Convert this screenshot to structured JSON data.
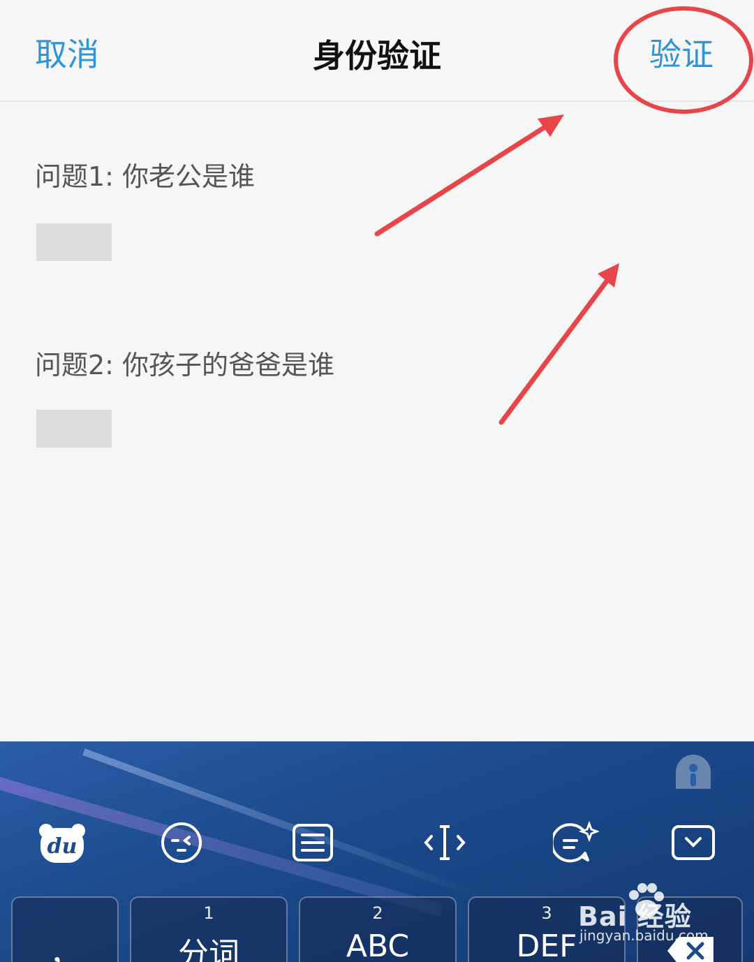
{
  "navbar": {
    "cancel_label": "取消",
    "title": "身份验证",
    "verify_label": "验证"
  },
  "questions": [
    {
      "label": "问题1: 你老公是谁"
    },
    {
      "label": "问题2: 你孩子的爸爸是谁"
    }
  ],
  "annotation": {
    "color": "#e8454b"
  },
  "keyboard": {
    "toolbar": [
      {
        "icon": "du-bear-logo-icon"
      },
      {
        "icon": "emoji-face-icon"
      },
      {
        "icon": "keyboard-layout-icon"
      },
      {
        "icon": "cursor-move-icon"
      },
      {
        "icon": "ai-chat-sparkle-icon"
      },
      {
        "icon": "collapse-keyboard-icon"
      }
    ],
    "keys": [
      {
        "num": "",
        "label": "，"
      },
      {
        "num": "1",
        "label": "分词"
      },
      {
        "num": "2",
        "label": "ABC"
      },
      {
        "num": "3",
        "label": "DEF"
      },
      {
        "num": "",
        "label": "delete-icon"
      }
    ]
  },
  "watermark": {
    "brand": "Bai  经验",
    "url": "jingyan.baidu.com"
  },
  "colors": {
    "accent": "#2f95d6",
    "keyboard_bg": "#1c4a8c"
  }
}
